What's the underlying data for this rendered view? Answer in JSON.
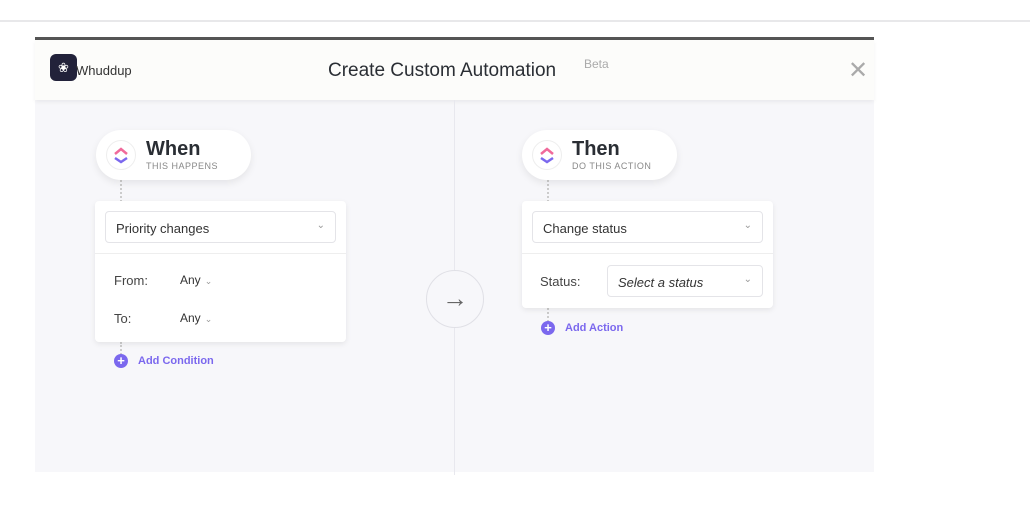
{
  "header": {
    "logo_icon": "brain-icon",
    "brand": "Whuddup",
    "title": "Create Custom Automation",
    "badge": "Beta",
    "close_icon": "close-icon"
  },
  "trigger": {
    "title": "When",
    "subtitle": "THIS HAPPENS",
    "select": "Priority changes",
    "from_label": "From:",
    "from_value": "Any",
    "to_label": "To:",
    "to_value": "Any",
    "add": "Add Condition"
  },
  "action": {
    "title": "Then",
    "subtitle": "DO THIS ACTION",
    "select": "Change status",
    "status_label": "Status:",
    "status_placeholder": "Select a status",
    "add": "Add Action"
  },
  "arrow_icon": "arrow-right-icon"
}
